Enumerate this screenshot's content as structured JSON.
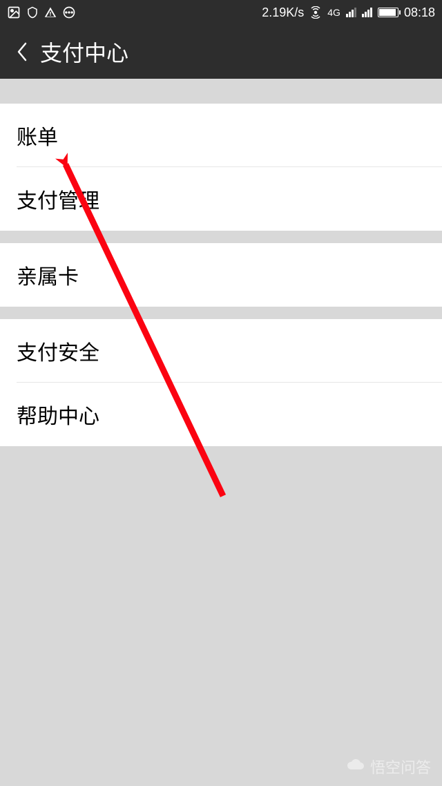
{
  "status": {
    "net_speed": "2.19K/s",
    "network_label": "4G",
    "time": "08:18"
  },
  "nav": {
    "title": "支付中心"
  },
  "groups": [
    {
      "items": [
        {
          "label": "账单"
        },
        {
          "label": "支付管理"
        }
      ]
    },
    {
      "items": [
        {
          "label": "亲属卡"
        }
      ]
    },
    {
      "items": [
        {
          "label": "支付安全"
        },
        {
          "label": "帮助中心"
        }
      ]
    }
  ],
  "watermark": "悟空问答"
}
